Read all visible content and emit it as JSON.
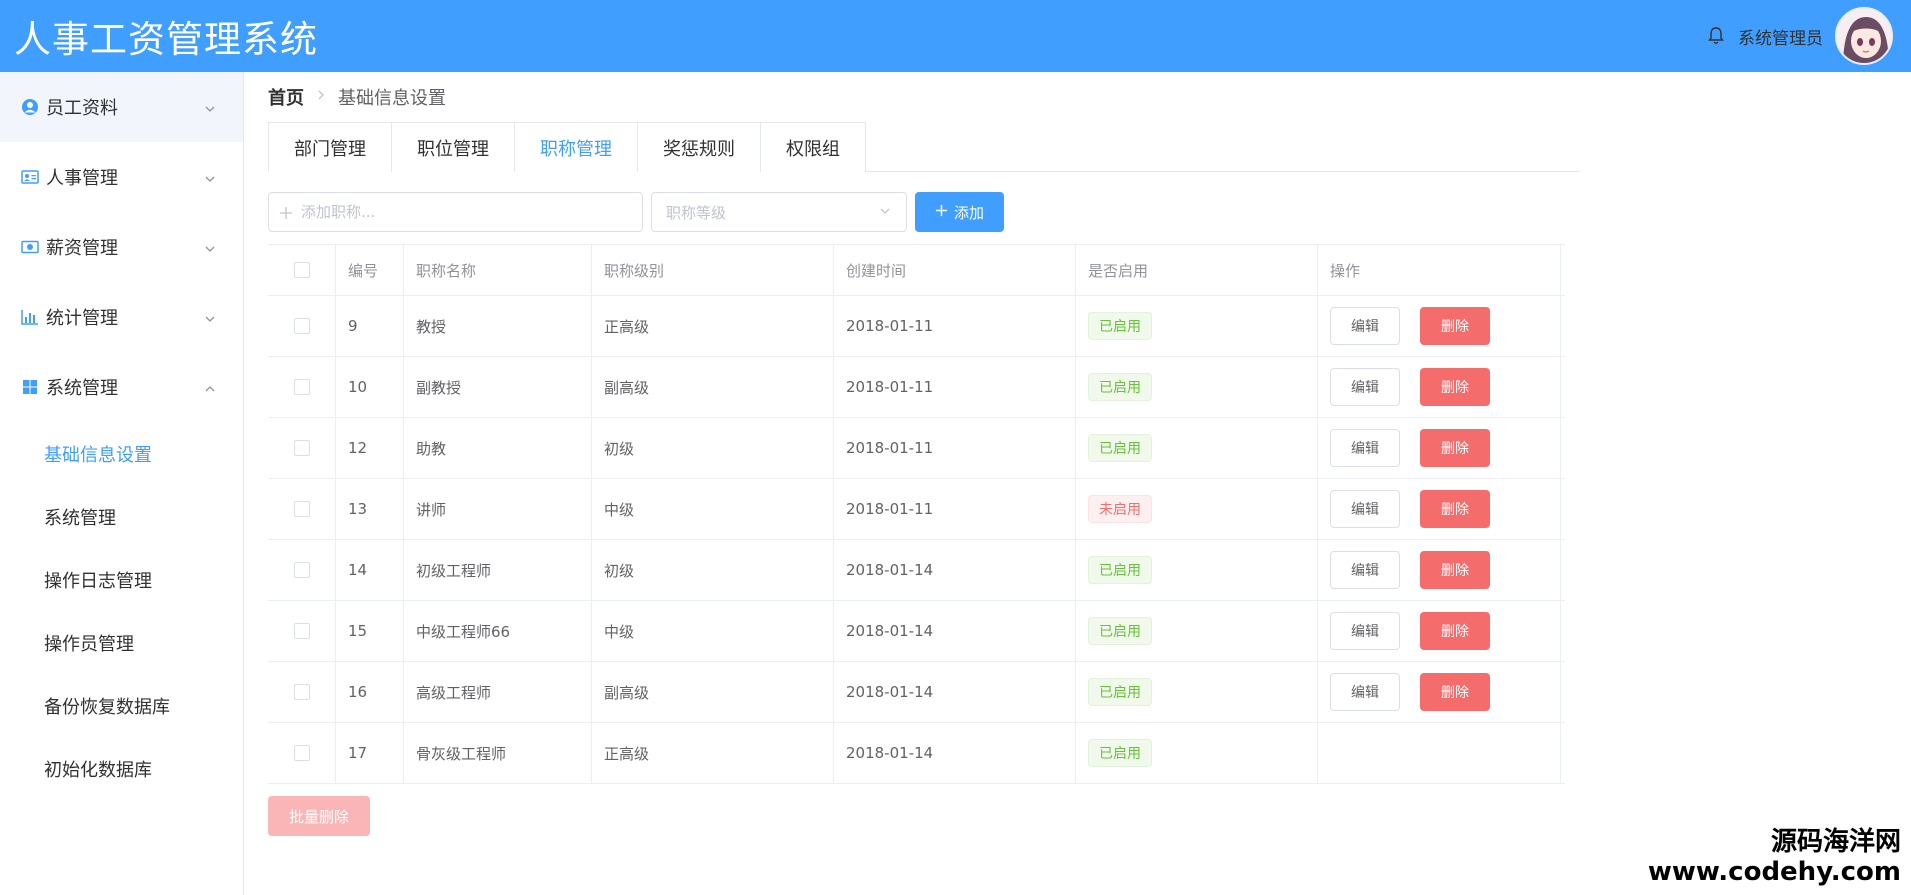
{
  "header": {
    "app_title": "人事工资管理系统",
    "user_name": "系统管理员"
  },
  "sidebar": {
    "items": [
      {
        "label": "员工资料",
        "icon": "user-circle-icon"
      },
      {
        "label": "人事管理",
        "icon": "id-card-icon"
      },
      {
        "label": "薪资管理",
        "icon": "money-icon"
      },
      {
        "label": "统计管理",
        "icon": "bar-chart-icon"
      },
      {
        "label": "系统管理",
        "icon": "windows-icon"
      }
    ],
    "sub_items": [
      "基础信息设置",
      "系统管理",
      "操作日志管理",
      "操作员管理",
      "备份恢复数据库",
      "初始化数据库"
    ]
  },
  "breadcrumb": {
    "home": "首页",
    "current": "基础信息设置"
  },
  "tabs": [
    "部门管理",
    "职位管理",
    "职称管理",
    "奖惩规则",
    "权限组"
  ],
  "toolbar": {
    "add_placeholder": "添加职称...",
    "level_placeholder": "职称等级",
    "add_label": "添加"
  },
  "table": {
    "headers": [
      "编号",
      "职称名称",
      "职称级别",
      "创建时间",
      "是否启用",
      "操作"
    ],
    "rows": [
      {
        "id": "9",
        "name": "教授",
        "level": "正高级",
        "date": "2018-01-11",
        "status": "已启用",
        "enabled": true
      },
      {
        "id": "10",
        "name": "副教授",
        "level": "副高级",
        "date": "2018-01-11",
        "status": "已启用",
        "enabled": true
      },
      {
        "id": "12",
        "name": "助教",
        "level": "初级",
        "date": "2018-01-11",
        "status": "已启用",
        "enabled": true
      },
      {
        "id": "13",
        "name": "讲师",
        "level": "中级",
        "date": "2018-01-11",
        "status": "未启用",
        "enabled": false
      },
      {
        "id": "14",
        "name": "初级工程师",
        "level": "初级",
        "date": "2018-01-14",
        "status": "已启用",
        "enabled": true
      },
      {
        "id": "15",
        "name": "中级工程师66",
        "level": "中级",
        "date": "2018-01-14",
        "status": "已启用",
        "enabled": true
      },
      {
        "id": "16",
        "name": "高级工程师",
        "level": "副高级",
        "date": "2018-01-14",
        "status": "已启用",
        "enabled": true
      },
      {
        "id": "17",
        "name": "骨灰级工程师",
        "level": "正高级",
        "date": "2018-01-14",
        "status": "已启用",
        "enabled": true
      }
    ],
    "edit_label": "编辑",
    "delete_label": "删除",
    "batch_delete_label": "批量删除"
  },
  "watermark": {
    "line1": "源码海洋网",
    "line2": "www.codehy.com"
  },
  "colors": {
    "primary": "#409eff",
    "danger": "#f56c6c",
    "success": "#67c23a"
  }
}
